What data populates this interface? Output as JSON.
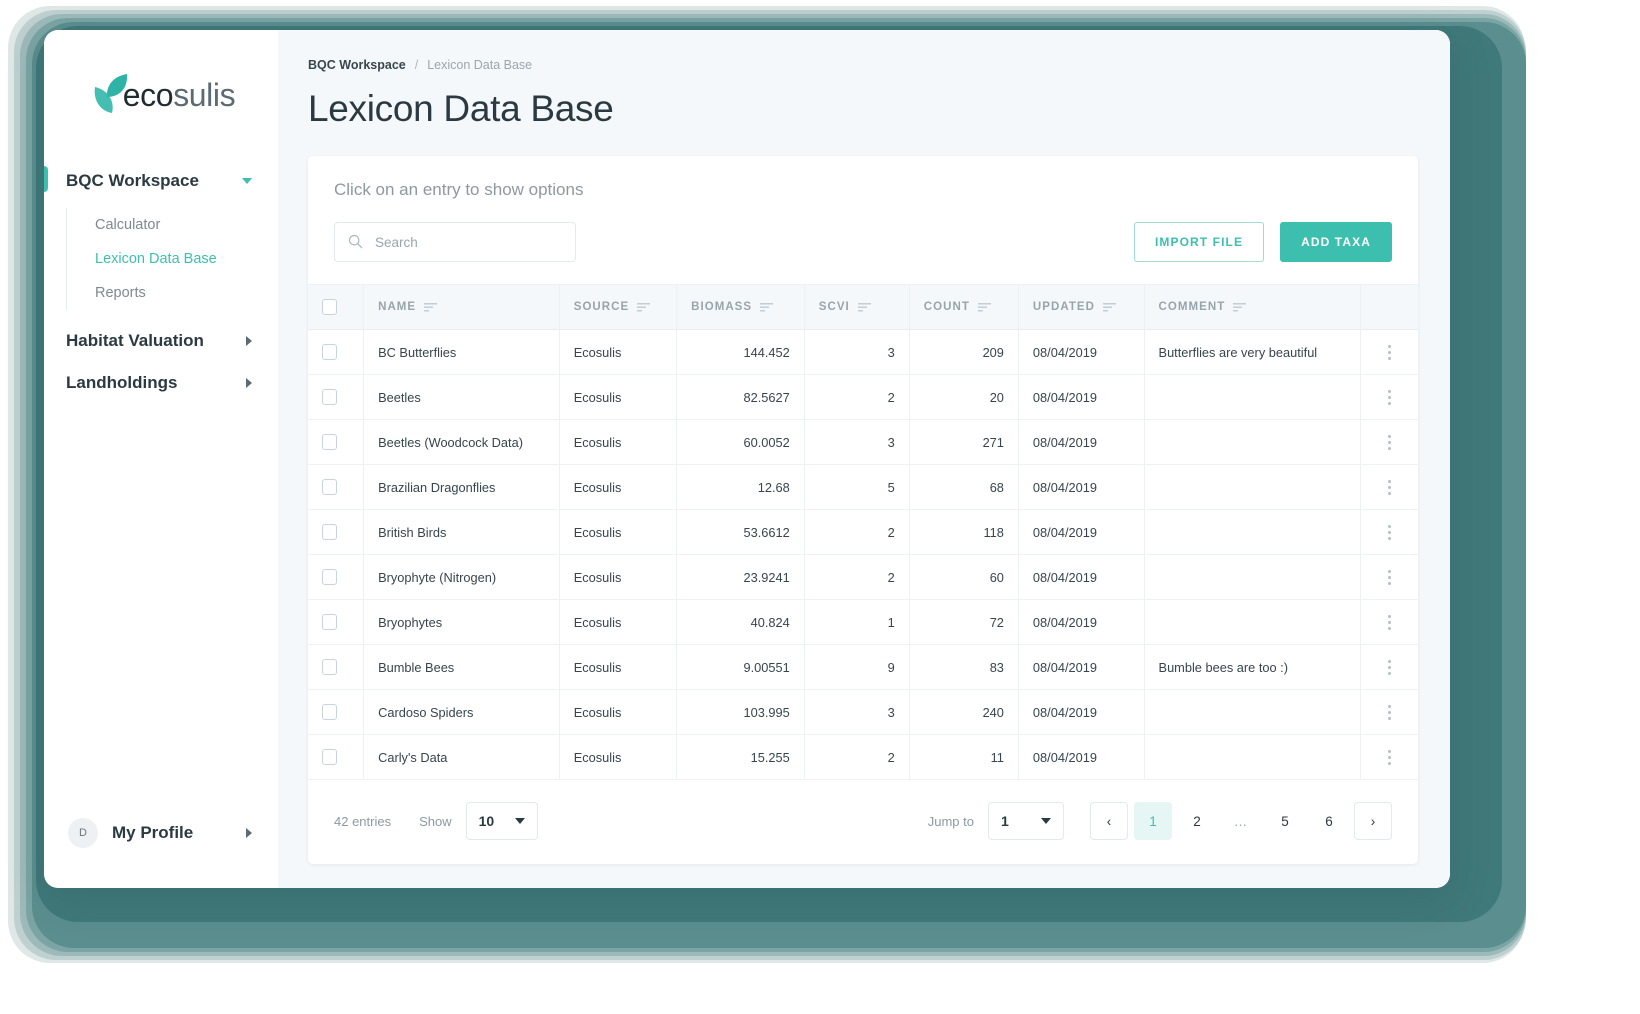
{
  "brand": {
    "name_bold": "eco",
    "name_light": "sulis"
  },
  "sidebar": {
    "groups": [
      {
        "label": "BQC Workspace",
        "expanded": true,
        "active": true,
        "items": [
          {
            "label": "Calculator",
            "selected": false
          },
          {
            "label": "Lexicon Data Base",
            "selected": true
          },
          {
            "label": "Reports",
            "selected": false
          }
        ]
      },
      {
        "label": "Habitat Valuation",
        "expanded": false,
        "active": false,
        "items": []
      },
      {
        "label": "Landholdings",
        "expanded": false,
        "active": false,
        "items": []
      }
    ],
    "profile": {
      "initial": "D",
      "label": "My Profile"
    }
  },
  "breadcrumb": {
    "parent": "BQC Workspace",
    "separator": "/",
    "current": "Lexicon Data Base"
  },
  "page": {
    "title": "Lexicon Data Base"
  },
  "panel": {
    "hint": "Click on an entry to show options",
    "search": {
      "value": "",
      "placeholder": "Search"
    },
    "import_label": "IMPORT FILE",
    "add_label": "ADD TAXA"
  },
  "table": {
    "columns": [
      "NAME",
      "SOURCE",
      "BIOMASS",
      "SCVI",
      "COUNT",
      "UPDATED",
      "COMMENT"
    ],
    "rows": [
      {
        "name": "BC Butterflies",
        "source": "Ecosulis",
        "biomass": "144.452",
        "scvi": "3",
        "count": "209",
        "updated": "08/04/2019",
        "comment": "Butterflies are very beautiful"
      },
      {
        "name": "Beetles",
        "source": "Ecosulis",
        "biomass": "82.5627",
        "scvi": "2",
        "count": "20",
        "updated": "08/04/2019",
        "comment": ""
      },
      {
        "name": "Beetles (Woodcock Data)",
        "source": "Ecosulis",
        "biomass": "60.0052",
        "scvi": "3",
        "count": "271",
        "updated": "08/04/2019",
        "comment": ""
      },
      {
        "name": "Brazilian Dragonflies",
        "source": "Ecosulis",
        "biomass": "12.68",
        "scvi": "5",
        "count": "68",
        "updated": "08/04/2019",
        "comment": ""
      },
      {
        "name": "British Birds",
        "source": "Ecosulis",
        "biomass": "53.6612",
        "scvi": "2",
        "count": "118",
        "updated": "08/04/2019",
        "comment": ""
      },
      {
        "name": "Bryophyte (Nitrogen)",
        "source": "Ecosulis",
        "biomass": "23.9241",
        "scvi": "2",
        "count": "60",
        "updated": "08/04/2019",
        "comment": ""
      },
      {
        "name": "Bryophytes",
        "source": "Ecosulis",
        "biomass": "40.824",
        "scvi": "1",
        "count": "72",
        "updated": "08/04/2019",
        "comment": ""
      },
      {
        "name": "Bumble Bees",
        "source": "Ecosulis",
        "biomass": "9.00551",
        "scvi": "9",
        "count": "83",
        "updated": "08/04/2019",
        "comment": "Bumble bees are too :)"
      },
      {
        "name": "Cardoso Spiders",
        "source": "Ecosulis",
        "biomass": "103.995",
        "scvi": "3",
        "count": "240",
        "updated": "08/04/2019",
        "comment": ""
      },
      {
        "name": "Carly's Data",
        "source": "Ecosulis",
        "biomass": "15.255",
        "scvi": "2",
        "count": "11",
        "updated": "08/04/2019",
        "comment": ""
      }
    ]
  },
  "footer": {
    "entries_text": "42 entries",
    "show_label": "Show",
    "page_size": "10",
    "jump_label": "Jump to",
    "jump_value": "1",
    "prev_glyph": "‹",
    "next_glyph": "›",
    "pages": [
      "1",
      "2",
      "…",
      "5",
      "6"
    ],
    "current_page": "1"
  },
  "colors": {
    "accent": "#3dbfb0",
    "accent_soft": "#e6f6f4",
    "text": "#2b3a42",
    "muted": "#8d99a0"
  }
}
